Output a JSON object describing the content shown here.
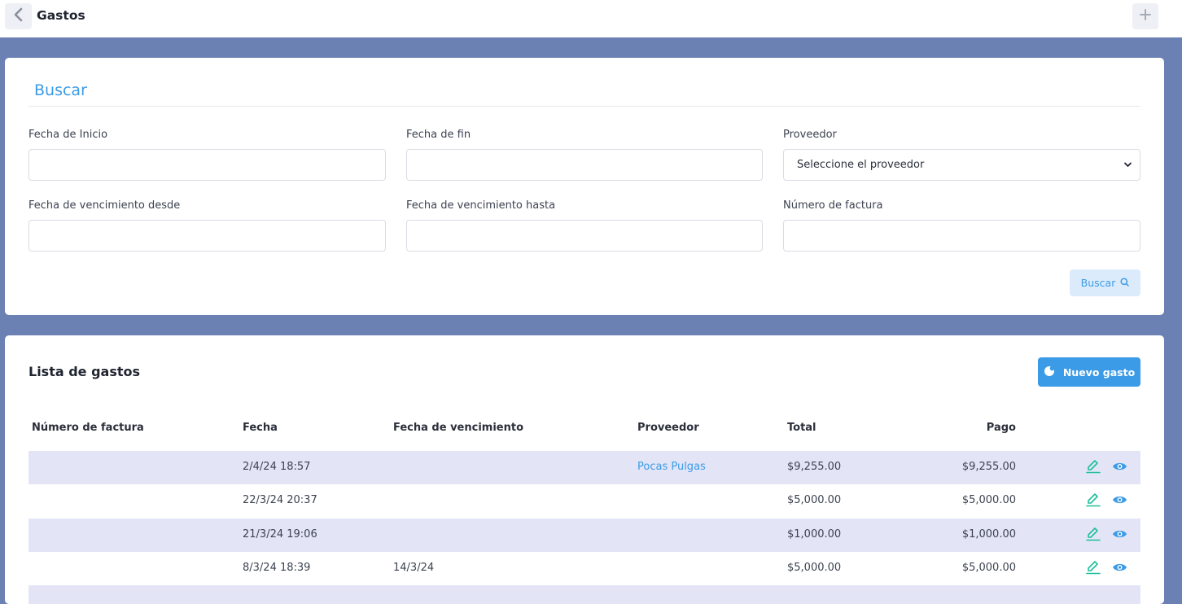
{
  "header": {
    "title": "Gastos",
    "back_icon": "chevron-left-icon",
    "add_icon": "plus-icon"
  },
  "search": {
    "title": "Buscar",
    "fields": {
      "start_date_label": "Fecha de Inicio",
      "start_date_value": "",
      "end_date_label": "Fecha de fin",
      "end_date_value": "",
      "supplier_label": "Proveedor",
      "supplier_selected": "Seleccione el proveedor",
      "due_from_label": "Fecha de vencimiento desde",
      "due_from_value": "",
      "due_to_label": "Fecha de vencimiento hasta",
      "due_to_value": "",
      "invoice_label": "Número de factura",
      "invoice_value": ""
    },
    "button_label": "Buscar",
    "button_icon": "search-icon"
  },
  "list": {
    "title": "Lista de gastos",
    "new_button_label": "Nuevo gasto",
    "columns": [
      "Número de factura",
      "Fecha",
      "Fecha de vencimiento",
      "Proveedor",
      "Total",
      "Pago"
    ],
    "rows": [
      {
        "invoice": "",
        "date": "2/4/24 18:57",
        "due": "",
        "supplier": "Pocas Pulgas",
        "total": "$9,255.00",
        "paid": "$9,255.00"
      },
      {
        "invoice": "",
        "date": "22/3/24 20:37",
        "due": "",
        "supplier": "",
        "total": "$5,000.00",
        "paid": "$5,000.00"
      },
      {
        "invoice": "",
        "date": "21/3/24 19:06",
        "due": "",
        "supplier": "",
        "total": "$1,000.00",
        "paid": "$1,000.00"
      },
      {
        "invoice": "",
        "date": "8/3/24 18:39",
        "due": "14/3/24",
        "supplier": "",
        "total": "$5,000.00",
        "paid": "$5,000.00"
      }
    ],
    "row_action_icons": [
      "edit-icon",
      "view-icon"
    ]
  },
  "colors": {
    "background": "#6b80b3",
    "accent": "#3b9be6",
    "row_shade": "#e3e5f6",
    "edit_icon": "#1dbf9a"
  }
}
